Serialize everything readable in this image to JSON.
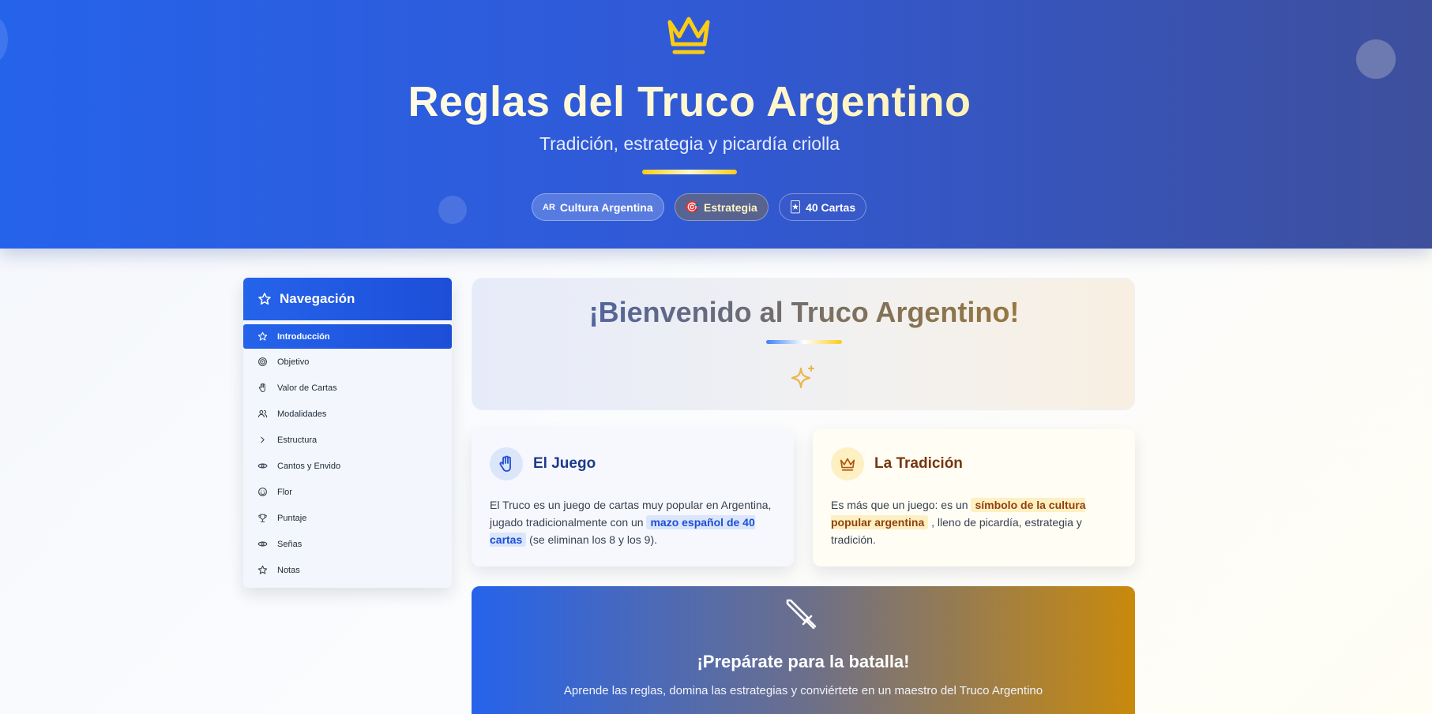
{
  "hero": {
    "title": "Reglas del Truco Argentino",
    "subtitle": "Tradición, estrategia y picardía criolla",
    "badges": [
      {
        "emoji": "AR",
        "label": "Cultura Argentina"
      },
      {
        "emoji": "🎯",
        "label": "Estrategia"
      },
      {
        "emoji": "🃏",
        "label": "40 Cartas"
      }
    ]
  },
  "sidebar": {
    "title": "Navegación",
    "items": [
      {
        "label": "Introducción",
        "icon": "star-icon",
        "active": true
      },
      {
        "label": "Objetivo",
        "icon": "target-icon"
      },
      {
        "label": "Valor de Cartas",
        "icon": "hand-icon"
      },
      {
        "label": "Modalidades",
        "icon": "users-icon"
      },
      {
        "label": "Estructura",
        "icon": "chevron-right-icon"
      },
      {
        "label": "Cantos y Envido",
        "icon": "eye-icon"
      },
      {
        "label": "Flor",
        "icon": "smile-icon"
      },
      {
        "label": "Puntaje",
        "icon": "trophy-icon"
      },
      {
        "label": "Señas",
        "icon": "eye-icon"
      },
      {
        "label": "Notas",
        "icon": "star-icon"
      }
    ]
  },
  "welcome": {
    "title": "¡Bienvenido al Truco Argentino!"
  },
  "cards": {
    "juego": {
      "title": "El Juego",
      "text_before": "El Truco es un juego de cartas muy popular en Argentina, jugado tradicionalmente con un",
      "highlight": "mazo español de 40 cartas",
      "text_after": "(se eliminan los 8 y los 9)."
    },
    "tradicion": {
      "title": "La Tradición",
      "text_before": "Es más que un juego: es un",
      "highlight": "símbolo de la cultura popular argentina",
      "text_after": ", lleno de picardía, estrategia y tradición."
    }
  },
  "battle": {
    "title": "¡Prepárate para la batalla!",
    "subtitle": "Aprende las reglas, domina las estrategias y conviértete en un maestro del Truco Argentino"
  },
  "colors": {
    "primary": "#2563eb",
    "gold": "#facc15",
    "dark_blue": "#1e3a8a",
    "brown": "#78350f"
  }
}
